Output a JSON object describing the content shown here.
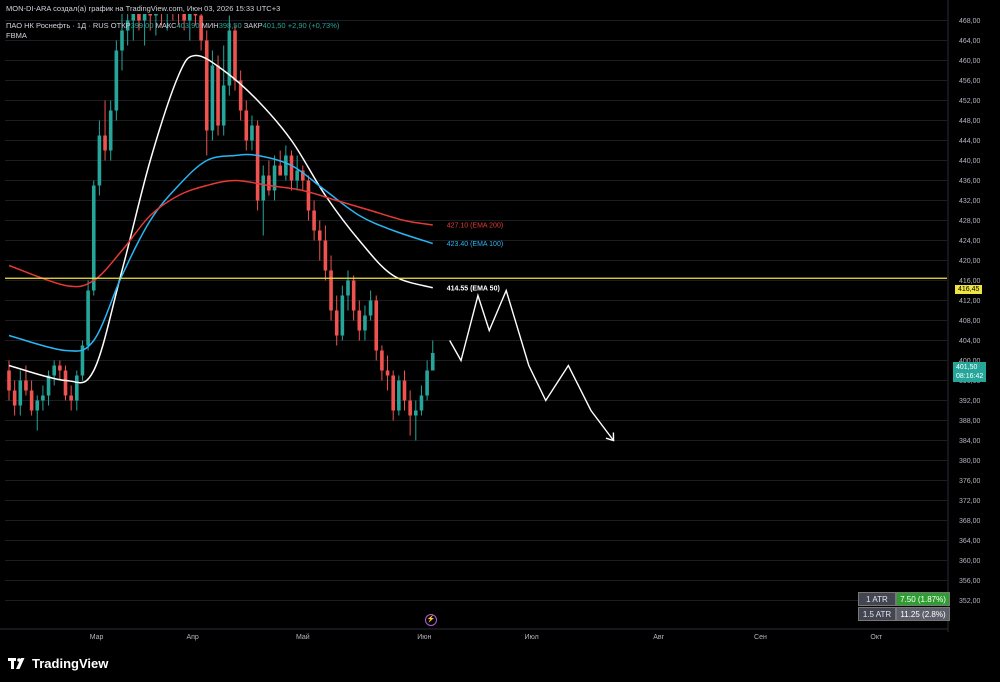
{
  "header": {
    "line1": "MON-DI-ARA создал(а) график на TradingView.com, Июн 03, 2026 15:33 UTC+3",
    "symbol": "ПАО НК Роснефть · 1Д · RUS",
    "o_label": "ОТКР",
    "o_value": "399,00",
    "h_label": "МАКС",
    "h_value": "403,90",
    "l_label": "МИН",
    "l_value": "398,50",
    "c_label": "ЗАКР",
    "c_value": "401,50",
    "change": "+2,90 (+0,73%)",
    "indicator": "FBMA"
  },
  "price_axis": {
    "ticks": [
      "468,00",
      "464,00",
      "460,00",
      "456,00",
      "452,00",
      "448,00",
      "444,00",
      "440,00",
      "436,00",
      "432,00",
      "428,00",
      "424,00",
      "420,00",
      "416,00",
      "412,00",
      "408,00",
      "404,00",
      "400,00",
      "396,00",
      "392,00",
      "388,00",
      "384,00",
      "380,00",
      "376,00",
      "372,00",
      "368,00",
      "364,00",
      "360,00",
      "356,00",
      "352,00"
    ],
    "hline_label": "416,45",
    "last_price": "401,50",
    "countdown": "08:16:42"
  },
  "time_axis": {
    "labels": [
      "Мар",
      "Апр",
      "Май",
      "Июн",
      "Июл",
      "Авг",
      "Сен",
      "Окт"
    ]
  },
  "ema_labels": {
    "ema200": "427.10 (EMA 200)",
    "ema100": "423.40 (EMA 100)",
    "ema50": "414.55 (EMA 50)"
  },
  "atr": [
    {
      "label": "1 ATR",
      "value": "7.50 (1.87%)"
    },
    {
      "label": "1.5 ATR",
      "value": "11.25 (2.8%)"
    }
  ],
  "footer": {
    "brand": "TradingView"
  },
  "colors": {
    "up": "#26a69a",
    "down": "#ef5350",
    "ema50": "#ffffff",
    "ema100": "#29b6f6",
    "ema200": "#e53935",
    "hline": "#f0e442",
    "projection": "#ffffff"
  },
  "chart_data": {
    "type": "candlestick",
    "timeframe": "1D",
    "ylim": [
      351,
      469
    ],
    "horizontal_line": 416.45,
    "candles": [
      [
        0,
        398,
        400,
        392,
        394
      ],
      [
        1,
        394,
        396,
        389,
        391
      ],
      [
        2,
        391,
        398,
        389,
        396
      ],
      [
        3,
        396,
        399,
        393,
        394
      ],
      [
        4,
        394,
        396,
        389,
        390
      ],
      [
        5,
        390,
        393,
        386,
        392
      ],
      [
        6,
        392,
        395,
        390,
        393
      ],
      [
        7,
        393,
        398,
        391,
        397
      ],
      [
        8,
        397,
        400,
        395,
        399
      ],
      [
        9,
        399,
        400,
        396,
        398
      ],
      [
        10,
        398,
        399,
        392,
        393
      ],
      [
        11,
        393,
        395,
        390,
        392
      ],
      [
        12,
        392,
        398,
        390,
        397
      ],
      [
        13,
        397,
        404,
        396,
        403
      ],
      [
        14,
        403,
        416,
        402,
        414
      ],
      [
        15,
        414,
        436,
        413,
        435
      ],
      [
        16,
        435,
        448,
        433,
        445
      ],
      [
        17,
        445,
        452,
        440,
        442
      ],
      [
        18,
        442,
        452,
        440,
        450
      ],
      [
        19,
        450,
        464,
        448,
        462
      ],
      [
        20,
        462,
        470,
        458,
        466
      ],
      [
        21,
        466,
        472,
        463,
        468
      ],
      [
        22,
        468,
        473,
        464,
        470
      ],
      [
        23,
        470,
        474,
        466,
        468
      ],
      [
        24,
        468,
        472,
        463,
        470
      ],
      [
        25,
        470,
        474,
        466,
        469
      ],
      [
        26,
        469,
        473,
        465,
        471
      ],
      [
        27,
        471,
        475,
        467,
        470
      ],
      [
        28,
        470,
        474,
        466,
        472
      ],
      [
        29,
        472,
        475,
        468,
        471
      ],
      [
        30,
        471,
        474,
        467,
        470
      ],
      [
        31,
        470,
        473,
        466,
        468
      ],
      [
        32,
        468,
        472,
        464,
        470
      ],
      [
        33,
        470,
        474,
        467,
        469
      ],
      [
        34,
        469,
        472,
        462,
        464
      ],
      [
        35,
        464,
        466,
        441,
        446
      ],
      [
        36,
        446,
        462,
        444,
        459
      ],
      [
        37,
        459,
        461,
        445,
        447
      ],
      [
        38,
        447,
        463,
        445,
        455
      ],
      [
        39,
        455,
        469,
        453,
        466
      ],
      [
        40,
        466,
        467,
        454,
        456
      ],
      [
        41,
        456,
        458,
        448,
        450
      ],
      [
        42,
        450,
        452,
        442,
        444
      ],
      [
        43,
        444,
        449,
        442,
        447
      ],
      [
        44,
        447,
        448,
        430,
        432
      ],
      [
        45,
        432,
        439,
        425,
        437
      ],
      [
        46,
        437,
        440,
        433,
        434
      ],
      [
        47,
        434,
        441,
        432,
        439
      ],
      [
        48,
        439,
        442,
        437,
        437
      ],
      [
        49,
        437,
        443,
        436,
        441
      ],
      [
        50,
        441,
        442,
        434,
        436
      ],
      [
        51,
        436,
        441,
        434,
        438
      ],
      [
        52,
        438,
        439,
        434,
        436
      ],
      [
        53,
        436,
        437,
        428,
        430
      ],
      [
        54,
        430,
        432,
        424,
        426
      ],
      [
        55,
        426,
        428,
        420,
        424
      ],
      [
        56,
        424,
        427,
        416,
        418
      ],
      [
        57,
        418,
        421,
        408,
        410
      ],
      [
        58,
        410,
        413,
        403,
        405
      ],
      [
        59,
        405,
        415,
        404,
        413
      ],
      [
        60,
        413,
        418,
        410,
        416
      ],
      [
        61,
        416,
        417,
        408,
        410
      ],
      [
        62,
        410,
        412,
        404,
        406
      ],
      [
        63,
        406,
        411,
        404,
        409
      ],
      [
        64,
        409,
        414,
        408,
        412
      ],
      [
        65,
        412,
        413,
        400,
        402
      ],
      [
        66,
        402,
        403,
        396,
        398
      ],
      [
        67,
        398,
        401,
        394,
        397
      ],
      [
        68,
        397,
        398,
        388,
        390
      ],
      [
        69,
        390,
        397,
        389,
        396
      ],
      [
        70,
        396,
        398,
        390,
        392
      ],
      [
        71,
        392,
        394,
        385,
        389
      ],
      [
        72,
        389,
        392,
        384,
        390
      ],
      [
        73,
        390,
        395,
        389,
        393
      ],
      [
        74,
        393,
        400,
        392,
        398
      ],
      [
        75,
        398,
        404,
        398,
        401.5
      ]
    ],
    "series": [
      {
        "name": "EMA 50",
        "last": 414.55,
        "values": [
          [
            0,
            399
          ],
          [
            10,
            396
          ],
          [
            15,
            398
          ],
          [
            20,
            418
          ],
          [
            25,
            440
          ],
          [
            30,
            457
          ],
          [
            33,
            461
          ],
          [
            38,
            458
          ],
          [
            44,
            452
          ],
          [
            50,
            444
          ],
          [
            56,
            433
          ],
          [
            62,
            424
          ],
          [
            68,
            417
          ],
          [
            75,
            414.55
          ]
        ]
      },
      {
        "name": "EMA 100",
        "last": 423.4,
        "values": [
          [
            0,
            405
          ],
          [
            10,
            402
          ],
          [
            15,
            404
          ],
          [
            20,
            417
          ],
          [
            25,
            428
          ],
          [
            30,
            435
          ],
          [
            35,
            440
          ],
          [
            40,
            441
          ],
          [
            44,
            441
          ],
          [
            50,
            439
          ],
          [
            56,
            434
          ],
          [
            62,
            429
          ],
          [
            68,
            426
          ],
          [
            75,
            423.4
          ]
        ]
      },
      {
        "name": "EMA 200",
        "last": 427.1,
        "values": [
          [
            0,
            419
          ],
          [
            10,
            415
          ],
          [
            15,
            416
          ],
          [
            20,
            422
          ],
          [
            25,
            429
          ],
          [
            30,
            433
          ],
          [
            35,
            435
          ],
          [
            40,
            436
          ],
          [
            46,
            435
          ],
          [
            52,
            434
          ],
          [
            58,
            432
          ],
          [
            64,
            430
          ],
          [
            70,
            428
          ],
          [
            75,
            427.1
          ]
        ]
      }
    ],
    "projection": [
      [
        78,
        404
      ],
      [
        80,
        400
      ],
      [
        83,
        413
      ],
      [
        85,
        406
      ],
      [
        88,
        414
      ],
      [
        92,
        399
      ],
      [
        95,
        392
      ],
      [
        99,
        399
      ],
      [
        103,
        390
      ],
      [
        107,
        384
      ]
    ]
  }
}
